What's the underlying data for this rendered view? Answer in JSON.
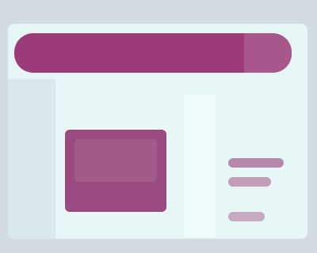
{
  "window": {
    "title": "",
    "accent_color": "#9b3b78",
    "background_color": "#e6f6f6"
  },
  "main": {
    "card": {
      "label": "",
      "color": "#9b4a7f"
    },
    "side_list": {
      "items": [
        "",
        "",
        ""
      ]
    }
  }
}
